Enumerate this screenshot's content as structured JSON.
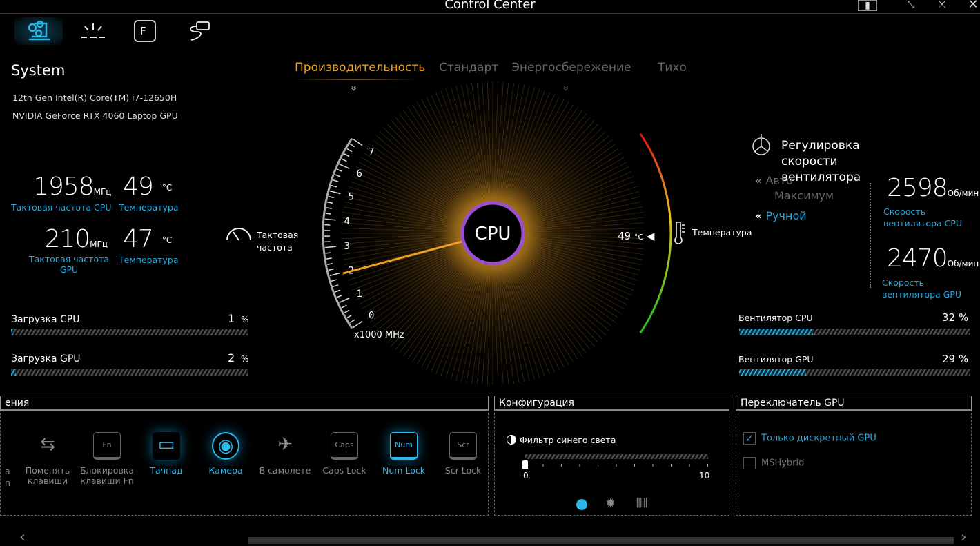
{
  "app": {
    "title": "Control Center",
    "window_buttons": [
      "info",
      "restore",
      "maximize",
      "close"
    ]
  },
  "nav": {
    "items": [
      "system-settings",
      "lighting",
      "function-keys",
      "power"
    ],
    "active": 0
  },
  "system": {
    "heading": "System",
    "cpu_name": "12th Gen Intel(R) Core(TM) i7-12650H",
    "gpu_name": "NVIDIA GeForce RTX 4060 Laptop GPU",
    "cpu_clock": "1958",
    "cpu_clock_unit": "МГц",
    "cpu_clock_label": "Тактовая частота CPU",
    "cpu_temp": "49",
    "cpu_temp_unit": "°C",
    "cpu_temp_label": "Температура",
    "gpu_clock": "210",
    "gpu_clock_unit": "МГц",
    "gpu_clock_label": "Тактовая частота GPU",
    "gpu_temp": "47",
    "gpu_temp_unit": "°C",
    "gpu_temp_label": "Температура",
    "cpu_load_label": "Загрузка CPU",
    "cpu_load": "1",
    "gpu_load_label": "Загрузка GPU",
    "gpu_load": "2",
    "pct": "%",
    "cpu_load_fraction": 0.01,
    "gpu_load_fraction": 0.02
  },
  "modes": {
    "items": [
      "Производительность",
      "Стандарт",
      "Энергосбережение",
      "Тихо"
    ],
    "active": 0
  },
  "gauge": {
    "center_label": "CPU",
    "clock_label": "Тактовая частота",
    "scale_unit": "x1000 MHz",
    "scale_ticks": [
      "0",
      "1",
      "2",
      "3",
      "4",
      "5",
      "6",
      "7"
    ],
    "clock_value_ghz": 1.958,
    "temp_value": "49",
    "temp_unit": "°C",
    "temp_label": "Температура",
    "colors": {
      "needle": "#f0a020",
      "glow": "#e8a224",
      "ring": "#9b4fd0"
    }
  },
  "fan": {
    "title": "Регулировка скорости вентилятора",
    "modes": [
      "Авто",
      "Максимум",
      "Ручной"
    ],
    "active_mode": "Ручной",
    "cpu_rpm": "2598",
    "gpu_rpm": "2470",
    "rpm_unit": "Об/мин",
    "cpu_rpm_label": "Скорость вентилятора CPU",
    "gpu_rpm_label": "Скорость вентилятора GPU",
    "cpu_fan_label": "Вентилятор CPU",
    "cpu_fan_pct": "32 %",
    "cpu_fan_fraction": 0.32,
    "gpu_fan_label": "Вентилятор GPU",
    "gpu_fan_pct": "29 %",
    "gpu_fan_fraction": 0.29
  },
  "keys_panel": {
    "title": "ения",
    "items": [
      {
        "label": "Поменять клавиши",
        "icon": "swap-keys-icon",
        "on": false
      },
      {
        "label": "Блокировка клавиши Fn",
        "icon": "Fn",
        "on": false
      },
      {
        "label": "Тачпад",
        "icon": "touchpad-icon",
        "on": true
      },
      {
        "label": "Камера",
        "icon": "camera-icon",
        "on": true
      },
      {
        "label": "В самолете",
        "icon": "airplane-icon",
        "on": false
      },
      {
        "label": "Caps Lock",
        "icon": "Caps",
        "on": false
      },
      {
        "label": "Num Lock",
        "icon": "Num",
        "on": true
      },
      {
        "label": "Scr Lock",
        "icon": "Scr",
        "on": false
      }
    ],
    "cut_left": [
      "а",
      "n"
    ]
  },
  "config": {
    "title": "Конфигурация",
    "filter_label": "Фильтр синего света",
    "slider_min": "0",
    "slider_max": "10",
    "slider_value": 0
  },
  "gpu_switch": {
    "title": "Переключатель GPU",
    "options": [
      {
        "label": "Только дискретный GPU",
        "checked": true
      },
      {
        "label": "MSHybrid",
        "checked": false
      }
    ]
  },
  "colors": {
    "accent": "#2aa7d9",
    "mode_active": "#e8a224",
    "bg": "#000000"
  }
}
